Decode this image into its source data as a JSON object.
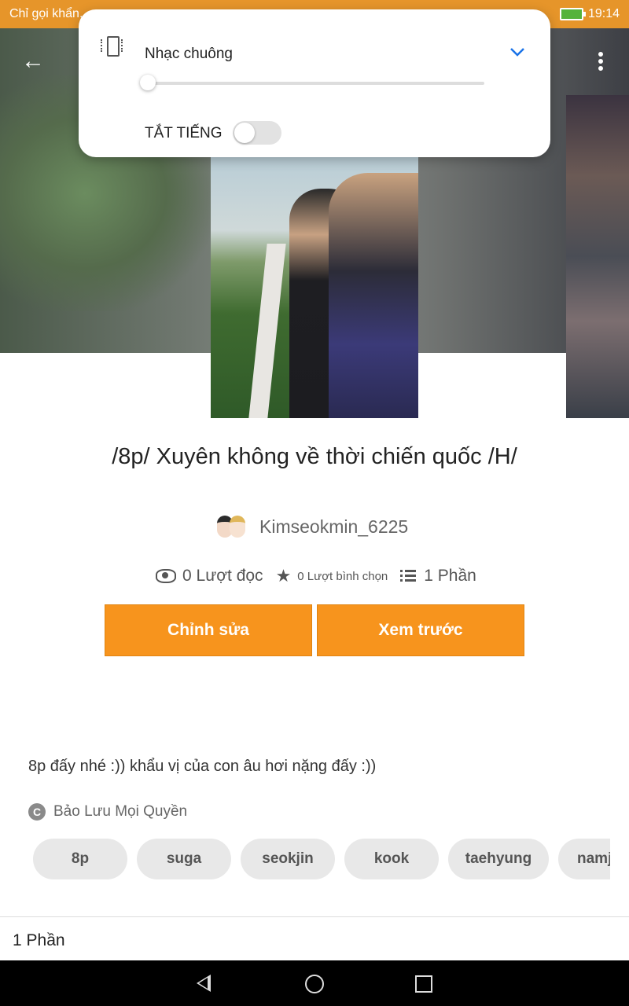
{
  "status_bar": {
    "left_text": "Chỉ gọi khẩn...",
    "time": "19:14"
  },
  "volume_panel": {
    "ring_label": "Nhạc chuông",
    "ring_level_percent": 0,
    "mute_label": "TẮT TIẾNG",
    "mute_on": false
  },
  "story": {
    "title": "/8p/ Xuyên không về thời chiến quốc /H/",
    "author": "Kimseokmin_6225",
    "stats": {
      "reads": "0 Lượt đọc",
      "votes": "0 Lượt bình chọn",
      "parts": "1 Phần"
    },
    "buttons": {
      "edit": "Chỉnh sửa",
      "preview": "Xem trước"
    },
    "description": "8p đấy nhé :)) khẩu vị của con âu hơi nặng đấy :))",
    "copyright": "Bảo Lưu Mọi Quyền",
    "tags": [
      "8p",
      "suga",
      "seokjin",
      "kook",
      "taehyung",
      "namj"
    ],
    "parts_header": "1 Phần"
  },
  "colors": {
    "accent": "#f7941d",
    "status_bar": "#e6952a",
    "link_blue": "#1a73e8"
  }
}
